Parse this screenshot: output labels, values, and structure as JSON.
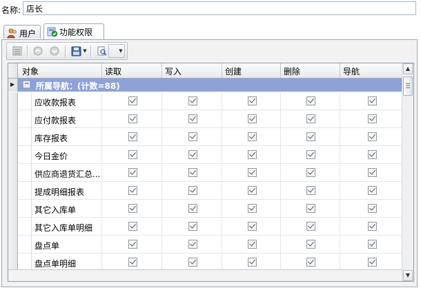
{
  "name": {
    "label": "名称:",
    "value": "店长"
  },
  "tabs": [
    {
      "label": "用户",
      "icon": "user-icon"
    },
    {
      "label": "功能权限",
      "icon": "permission-icon"
    }
  ],
  "toolbar": {
    "icons": [
      "list-icon",
      "up-icon",
      "down-icon",
      "save-icon",
      "dropdown-arrow-icon",
      "preview-icon",
      "dropdown-arrow-icon"
    ]
  },
  "grid": {
    "columns": [
      "对象",
      "读取",
      "写入",
      "创建",
      "删除",
      "导航"
    ],
    "group": {
      "expander": "−",
      "label": "所属导航：(计数=88)"
    },
    "rows": [
      {
        "name": "应收款报表",
        "read": true,
        "write": true,
        "create": true,
        "delete": true,
        "navigate": true
      },
      {
        "name": "应付款报表",
        "read": true,
        "write": true,
        "create": true,
        "delete": true,
        "navigate": true
      },
      {
        "name": "库存报表",
        "read": true,
        "write": true,
        "create": true,
        "delete": true,
        "navigate": true
      },
      {
        "name": "今日金价",
        "read": true,
        "write": true,
        "create": true,
        "delete": true,
        "navigate": true
      },
      {
        "name": "供应商退货汇总...",
        "read": true,
        "write": true,
        "create": true,
        "delete": true,
        "navigate": true
      },
      {
        "name": "提成明细报表",
        "read": true,
        "write": true,
        "create": true,
        "delete": true,
        "navigate": true
      },
      {
        "name": "其它入库单",
        "read": true,
        "write": true,
        "create": true,
        "delete": true,
        "navigate": true
      },
      {
        "name": "其它入库单明细",
        "read": true,
        "write": true,
        "create": true,
        "delete": true,
        "navigate": true
      },
      {
        "name": "盘点单",
        "read": true,
        "write": true,
        "create": true,
        "delete": true,
        "navigate": true
      },
      {
        "name": "盘点单明细",
        "read": true,
        "write": true,
        "create": true,
        "delete": true,
        "navigate": true
      }
    ]
  },
  "colors": {
    "group_row": "#8fa2d8",
    "border": "#9aa6b6"
  }
}
